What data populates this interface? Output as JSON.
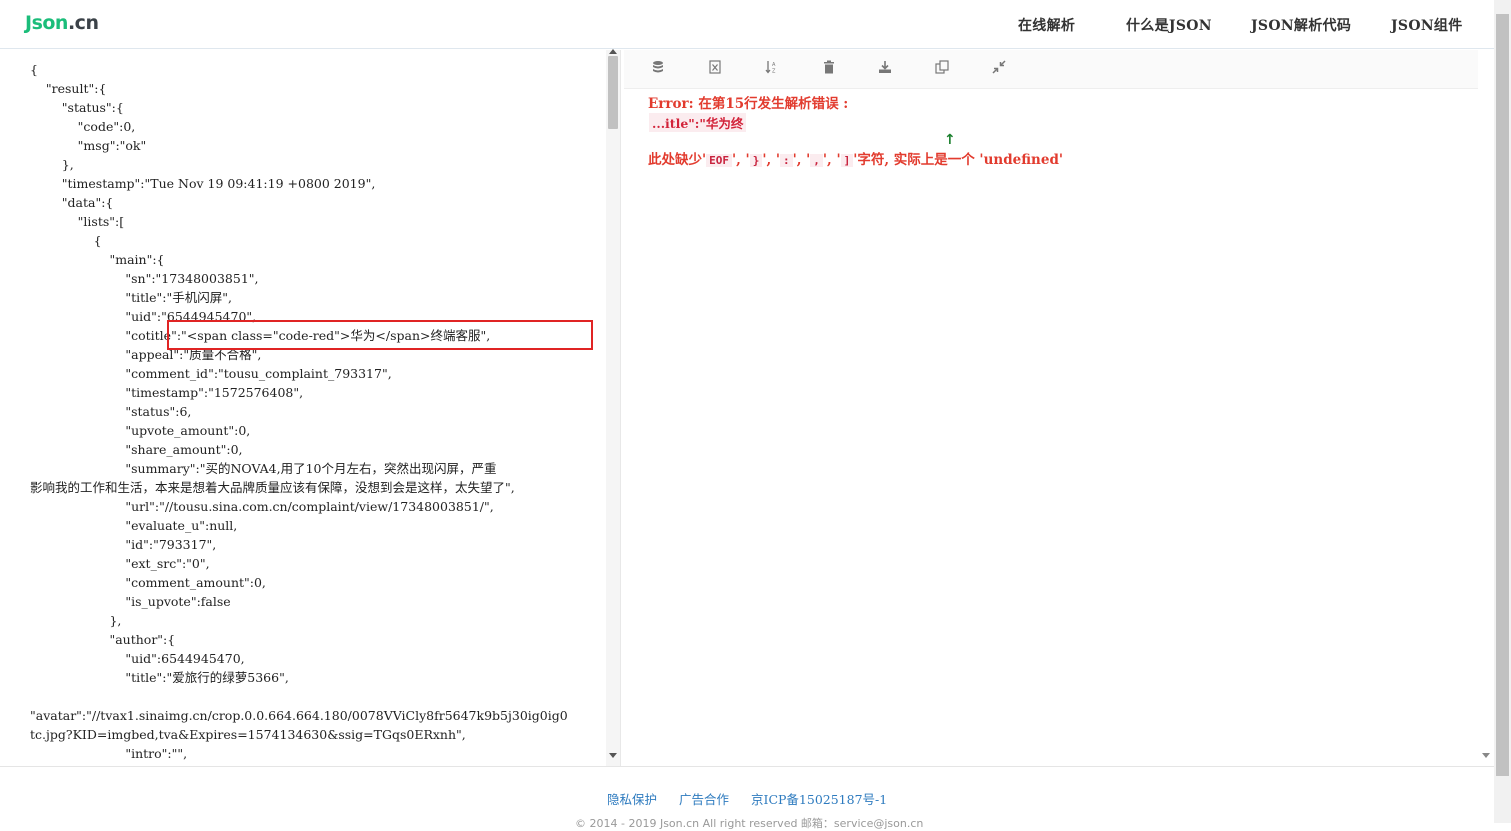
{
  "header": {
    "logo_main": "Json",
    "logo_dot": ".cn",
    "nav": [
      "在线解析",
      "什么是JSON",
      "JSON解析代码",
      "JSON组件"
    ]
  },
  "editor": {
    "lines": [
      "{",
      "    \"result\":{",
      "        \"status\":{",
      "            \"code\":0,",
      "            \"msg\":\"ok\"",
      "        },",
      "        \"timestamp\":\"Tue Nov 19 09:41:19 +0800 2019\",",
      "        \"data\":{",
      "            \"lists\":[",
      "                {",
      "                    \"main\":{",
      "                        \"sn\":\"17348003851\",",
      "                        \"title\":\"手机闪屏\",",
      "                        \"uid\":\"6544945470\",",
      "                        \"cotitle\":\"<span class=\"code-red\">华为</span>终端客服\",",
      "                        \"appeal\":\"质量不合格\",",
      "                        \"comment_id\":\"tousu_complaint_793317\",",
      "                        \"timestamp\":\"1572576408\",",
      "                        \"status\":6,",
      "                        \"upvote_amount\":0,",
      "                        \"share_amount\":0,",
      "                        \"summary\":\"买的NOVA4,用了10个月左右，突然出现闪屏，严重",
      "影响我的工作和生活，本来是想着大品牌质量应该有保障，没想到会是这样，太失望了\",",
      "                        \"url\":\"//tousu.sina.com.cn/complaint/view/17348003851/\",",
      "                        \"evaluate_u\":null,",
      "                        \"id\":\"793317\",",
      "                        \"ext_src\":\"0\",",
      "                        \"comment_amount\":0,",
      "                        \"is_upvote\":false",
      "                    },",
      "                    \"author\":{",
      "                        \"uid\":6544945470,",
      "                        \"title\":\"爱旅行的绿萝5366\",",
      "",
      "\"avatar\":\"//tvax1.sinaimg.cn/crop.0.0.664.664.180/0078VViCly8fr5647k9b5j30ig0ig0",
      "tc.jpg?KID=imgbed,tva&Expires=1574134630&ssig=TGqs0ERxnh\",",
      "                        \"intro\":\"\","
    ]
  },
  "error": {
    "title": "Error: 在第15行发生解析错误 :",
    "snippet": "...itle\":\"华为终",
    "caret": "↑",
    "msg_prefix": "此处缺少'",
    "tokens": [
      "EOF",
      "}",
      ":",
      ",",
      "]"
    ],
    "msg_suffix": "'字符, 实际上是一个 'undefined'"
  },
  "toolbar": {
    "icons": [
      "database-icon",
      "excel-icon",
      "sort-icon",
      "trash-icon",
      "download-icon",
      "copy-icon",
      "compress-icon"
    ]
  },
  "footer": {
    "links": [
      "隐私保护",
      "广告合作",
      "京ICP备15025187号-1"
    ],
    "copyright": "© 2014 - 2019 Json.cn All right reserved  邮箱：service@json.cn"
  }
}
